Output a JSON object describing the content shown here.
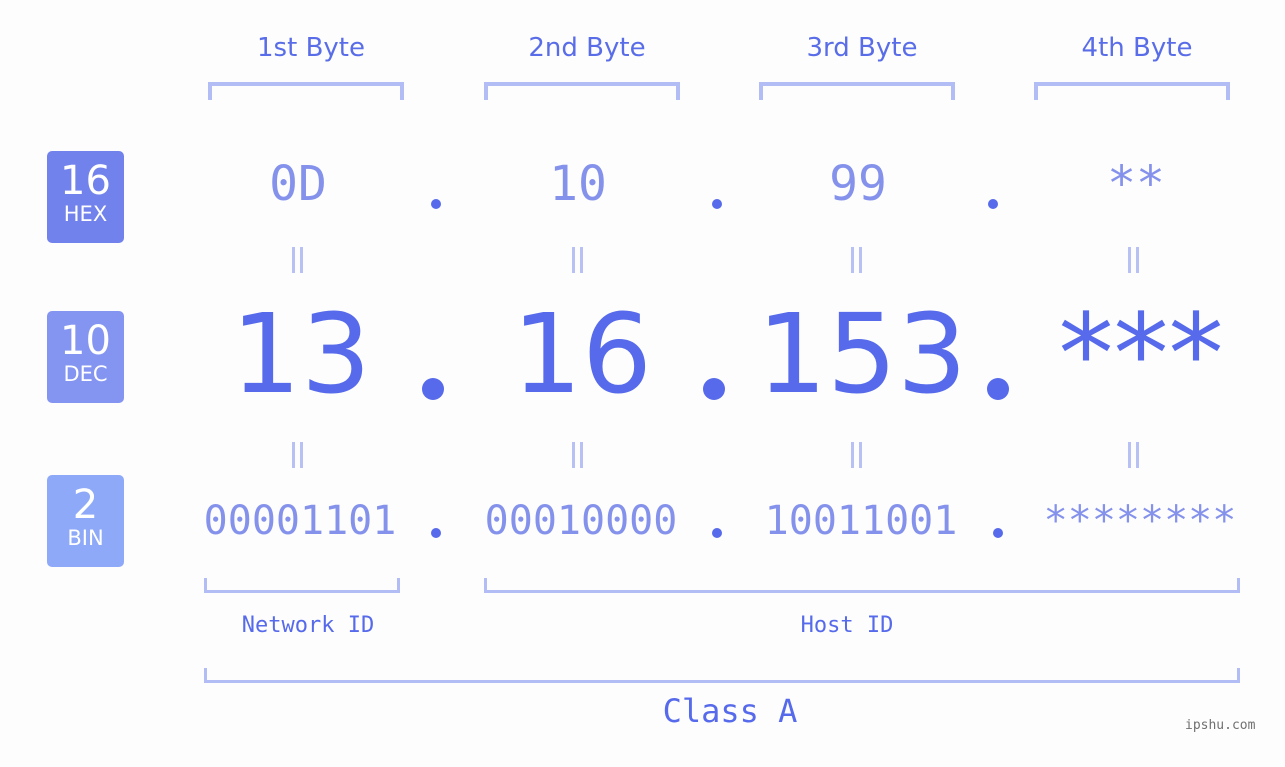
{
  "byte_headers": [
    "1st Byte",
    "2nd Byte",
    "3rd Byte",
    "4th Byte"
  ],
  "badges": [
    {
      "number": "16",
      "label": "HEX",
      "color": "#7282ec"
    },
    {
      "number": "10",
      "label": "DEC",
      "color": "#8494f1"
    },
    {
      "number": "2",
      "label": "BIN",
      "color": "#8ea9f8"
    }
  ],
  "hex": [
    "0D",
    "10",
    "99",
    "**"
  ],
  "dec": [
    "13",
    "16",
    "153",
    "***"
  ],
  "bin": [
    "00001101",
    "00010000",
    "10011001",
    "********"
  ],
  "separator": ".",
  "network_id_label": "Network ID",
  "host_id_label": "Host ID",
  "class_label": "Class A",
  "watermark": "ipshu.com",
  "colors": {
    "accent": "#566aeb",
    "muted_value": "#8592ec",
    "bracket": "#b2bdf6"
  }
}
